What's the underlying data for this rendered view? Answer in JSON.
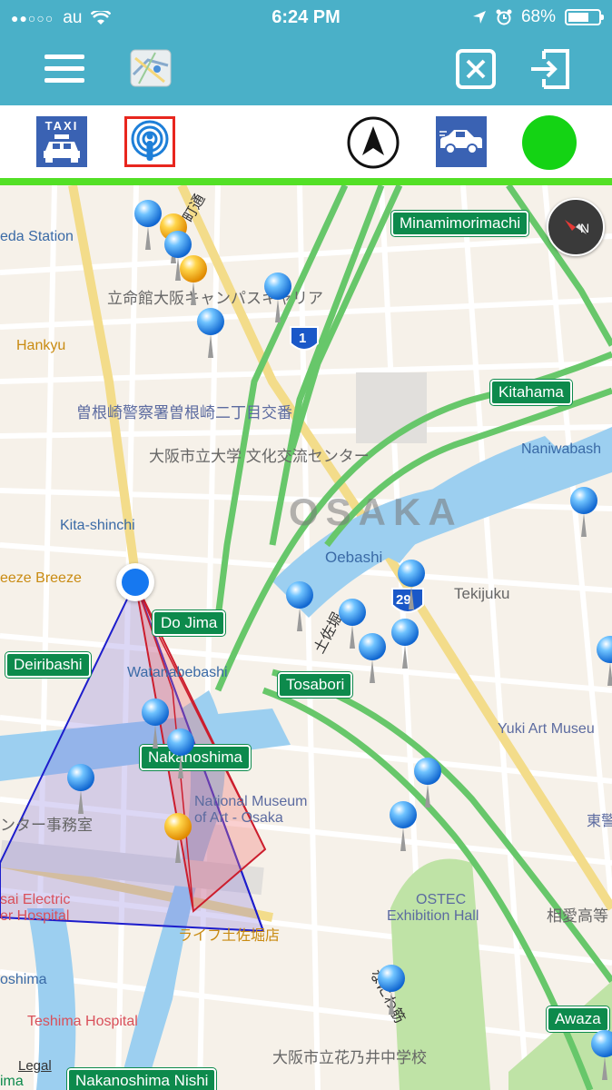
{
  "status_bar": {
    "signal": "●●○○○",
    "carrier": "au",
    "time": "6:24 PM",
    "battery": "68%",
    "battery_level": 0.68
  },
  "toolbar": {
    "menu_icon": "hamburger-menu-icon",
    "map_thumbnail_icon": "map-thumbnail-icon",
    "close_icon": "close-box-icon",
    "exit_icon": "exit-icon"
  },
  "second_toolbar": {
    "taxi_label": "TAXI",
    "broadcast_icon": "broadcast-person-icon",
    "compass_arrow_icon": "navigation-arrow-icon",
    "car_icon": "car-icon",
    "status_color": "#14d314"
  },
  "map": {
    "station_signs": {
      "minamimorimachi": "Minamimorimachi",
      "kitahama": "Kitahama",
      "do_jima": "Do Jima",
      "deiribashi": "Deiribashi",
      "tosabori": "Tosabori",
      "nakanoshima": "Nakanoshima",
      "awaza": "Awaza",
      "nakanoshima_nishi": "Nakanoshima Nishi"
    },
    "labels": {
      "umeda_station": "eda Station",
      "hankyu": "Hankyu",
      "ritsumeikan": "立命館大阪キャンパスキャリア",
      "sonezaki_police": "曽根崎警察署曽根崎二丁目交番",
      "osaka_city_univ": "大阪市立大学 文化交流センター",
      "kita_shinchi": "Kita-shinchi",
      "breeze": "eeze Breeze",
      "oebashi": "Oebashi",
      "tekijuku": "Tekijuku",
      "naniwabashi": "Naniwabash",
      "watanabebashi": "Watanabebashi",
      "yuki_art": "Yuki Art Museu",
      "national_museum_1": "National Museum",
      "national_museum_2": "of Art - Osaka",
      "office": "ンター事務室",
      "kansai_electric_1": "sai Electric",
      "kansai_electric_2": "er Hospital",
      "life": "ライフ土佐堀店",
      "ostec_1": "OSTEC",
      "ostec_2": "Exhibition Hall",
      "soai": "相愛高等",
      "higashi": "東警",
      "oshima": "oshima",
      "teshima": "Teshima Hospital",
      "hananoi": "大阪市立花乃井中学校",
      "naniwa_suji": "なにわ筋",
      "tosabori_river": "土佐堀",
      "machi_dori": "町通",
      "nishi": "ima",
      "route_1": "1",
      "route_29": "29"
    },
    "city_label": "OSAKA",
    "legal": "Legal"
  }
}
